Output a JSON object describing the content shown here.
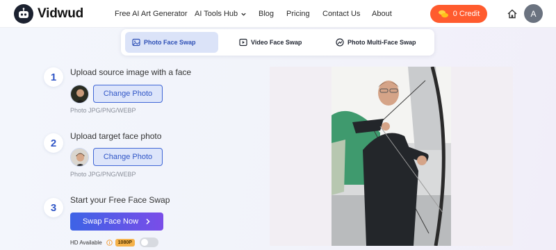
{
  "header": {
    "brand": "Vidwud",
    "nav": [
      {
        "label": "Free AI Art Generator"
      },
      {
        "label": "AI Tools Hub"
      },
      {
        "label": "Blog"
      },
      {
        "label": "Pricing"
      },
      {
        "label": "Contact Us"
      },
      {
        "label": "About"
      }
    ],
    "credit_label": "0 Credit",
    "avatar_letter": "A",
    "icons": {
      "home": "home-icon",
      "credit": "coins-icon",
      "dropdown": "chevron-down-icon"
    },
    "accent": "#ff5b2e"
  },
  "tabs": [
    {
      "label": "Photo Face Swap",
      "icon": "image-icon",
      "active": true
    },
    {
      "label": "Video Face Swap",
      "icon": "video-play-icon",
      "active": false
    },
    {
      "label": "Photo Multi-Face Swap",
      "icon": "multi-face-icon",
      "active": false
    }
  ],
  "steps": [
    {
      "number": "1",
      "title": "Upload source image with a face",
      "button": "Change Photo",
      "hint": "Photo JPG/PNG/WEBP"
    },
    {
      "number": "2",
      "title": "Upload target face photo",
      "button": "Change Photo",
      "hint": "Photo JPG/PNG/WEBP"
    },
    {
      "number": "3",
      "title": "Start your Free Face Swap",
      "button": "Swap Face Now"
    }
  ],
  "hd": {
    "label": "HD Available",
    "badge": "1080P",
    "enabled": false
  },
  "colors": {
    "primary": "#2f55c6",
    "gradient_start": "#3d63e6",
    "gradient_end": "#7a4de8",
    "badge": "#f5b24a"
  }
}
